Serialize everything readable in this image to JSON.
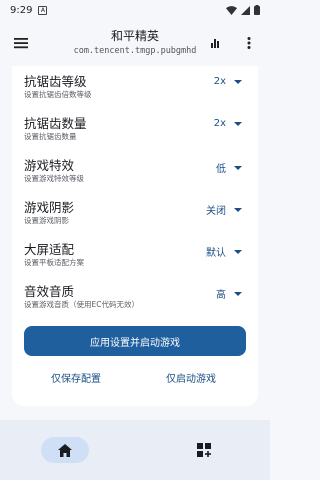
{
  "status_bar": {
    "time": "9:29",
    "app_icon_letter": "A"
  },
  "app_bar": {
    "title": "和平精英",
    "subtitle": "com.tencent.tmgp.pubgmhd",
    "icons": [
      "menu-icon",
      "chart-icon",
      "more-vert-icon"
    ]
  },
  "settings": [
    {
      "title": "抗锯齿等级",
      "desc": "设置抗锯齿倍数等级",
      "value": "2x"
    },
    {
      "title": "抗锯齿数量",
      "desc": "设置抗锯齿数量",
      "value": "2x"
    },
    {
      "title": "游戏特效",
      "desc": "设置游戏特效等级",
      "value": "低"
    },
    {
      "title": "游戏阴影",
      "desc": "设置游戏阴影",
      "value": "关闭"
    },
    {
      "title": "大屏适配",
      "desc": "设置平板适配方案",
      "value": "默认"
    },
    {
      "title": "音效音质",
      "desc": "设置游戏音质（使用EC代码无效）",
      "value": "高"
    }
  ],
  "actions": {
    "apply_launch": "应用设置并启动游戏",
    "save_only": "仅保存配置",
    "launch_only": "仅启动游戏"
  },
  "bottom_nav": {
    "items": [
      "home-icon",
      "apps-add-icon"
    ],
    "selected": "home-icon"
  },
  "colors": {
    "accent": "#1f5f9e",
    "value_text": "#1a4f86",
    "nav_bg": "#e8edf6",
    "nav_selected": "#cfe0f6"
  }
}
